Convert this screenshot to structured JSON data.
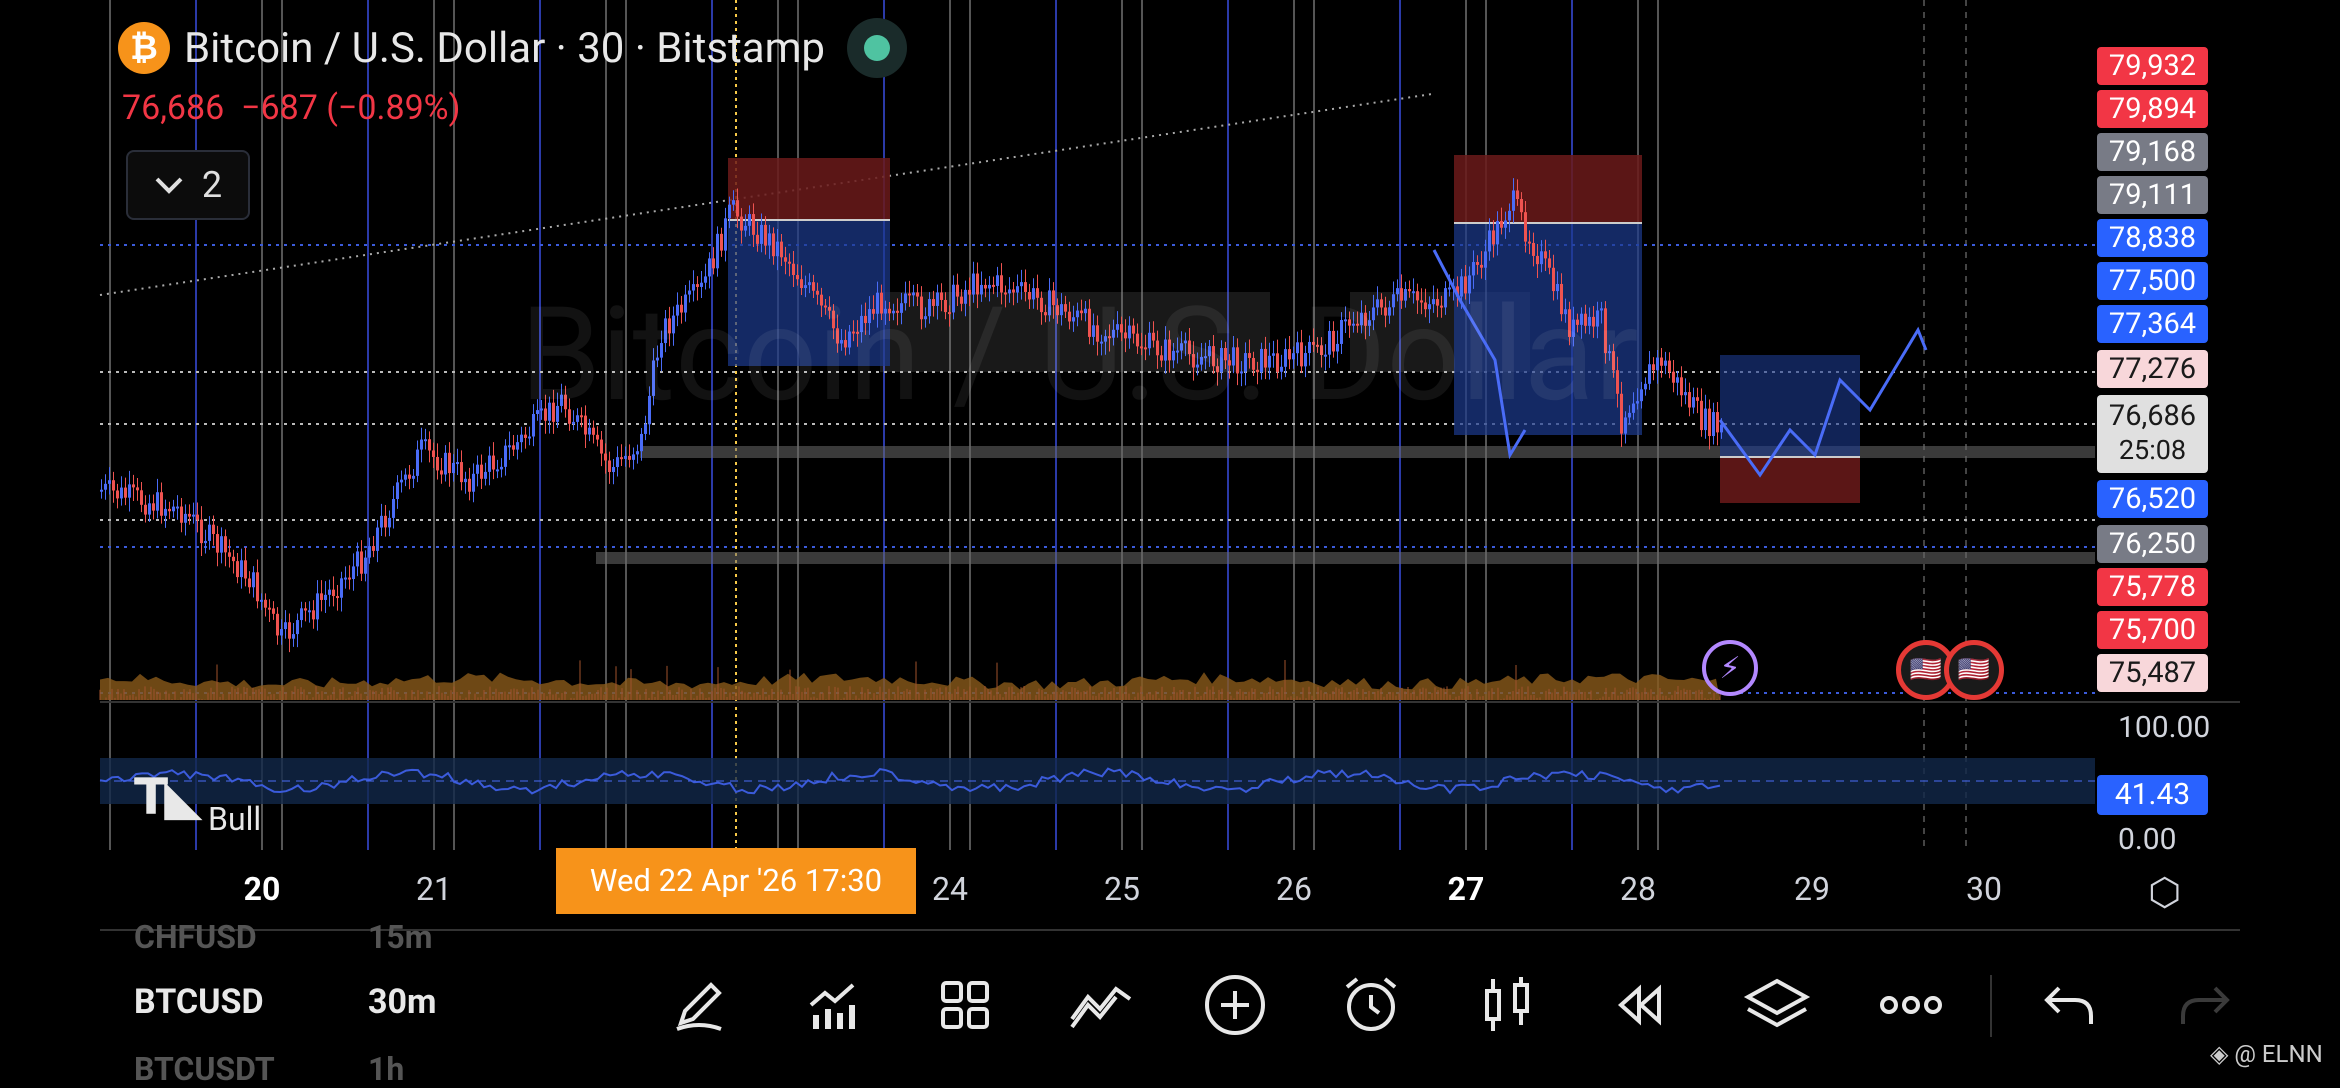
{
  "header": {
    "coin_symbol": "₿",
    "title": "Bitcoin / U.S. Dollar · 30 · Bitstamp",
    "last_price": "76,686",
    "change": "−687 (−0.89%)",
    "indicator_count": "2",
    "watermark": "Bitcoin / U.S. Dollar"
  },
  "price_labels": [
    {
      "text": "79,932",
      "bg": "#f23645",
      "fg": "#ffffff"
    },
    {
      "text": "79,894",
      "bg": "#f23645",
      "fg": "#ffffff"
    },
    {
      "text": "79,168",
      "bg": "#787b86",
      "fg": "#ffffff"
    },
    {
      "text": "79,111",
      "bg": "#787b86",
      "fg": "#ffffff"
    },
    {
      "text": "78,838",
      "bg": "#2962ff",
      "fg": "#ffffff"
    },
    {
      "text": "77,500",
      "bg": "#2962ff",
      "fg": "#ffffff"
    },
    {
      "text": "77,364",
      "bg": "#2962ff",
      "fg": "#ffffff"
    },
    {
      "text": "77,276",
      "bg": "#f8d7da",
      "fg": "#1a1a1a"
    },
    {
      "text": "76,686",
      "bg": "#e0e0e0",
      "fg": "#1a1a1a"
    },
    {
      "text": "76,520",
      "bg": "#2962ff",
      "fg": "#ffffff"
    },
    {
      "text": "76,250",
      "bg": "#787b86",
      "fg": "#ffffff"
    },
    {
      "text": "75,778",
      "bg": "#f23645",
      "fg": "#ffffff"
    },
    {
      "text": "75,700",
      "bg": "#f23645",
      "fg": "#ffffff"
    },
    {
      "text": "75,487",
      "bg": "#f8d7da",
      "fg": "#1a1a1a"
    }
  ],
  "countdown": "25:08",
  "rsi": {
    "top": "100.00",
    "value": "41.43",
    "bottom": "0.00",
    "label": "Bull"
  },
  "x_axis": {
    "ticks": [
      {
        "label": "20",
        "bold": true
      },
      {
        "label": "21",
        "bold": false
      },
      {
        "label": "24",
        "bold": false
      },
      {
        "label": "25",
        "bold": false
      },
      {
        "label": "26",
        "bold": false
      },
      {
        "label": "27",
        "bold": true
      },
      {
        "label": "28",
        "bold": false
      },
      {
        "label": "29",
        "bold": false
      },
      {
        "label": "30",
        "bold": false
      }
    ],
    "crosshair_label": "Wed 22 Apr '26   17:30"
  },
  "watchlist": {
    "ghost_top": {
      "symbol": "CHFUSD",
      "interval": "15m"
    },
    "current": {
      "symbol": "BTCUSD",
      "interval": "30m"
    },
    "ghost_bottom": {
      "symbol": "BTCUSDT",
      "interval": "1h"
    }
  },
  "toolbar_icons": [
    "pen-icon",
    "chart-line-icon",
    "grid-icon",
    "draw-tools-icon",
    "plus-circle-icon",
    "alarm-icon",
    "candles-icon",
    "replay-icon",
    "layers-icon",
    "more-icon",
    "undo-icon",
    "redo-icon"
  ],
  "credit": "◈ @ ELNN",
  "colors": {
    "up": "#4a6cf7",
    "down": "#ef5350",
    "volume": "#8a5a1a",
    "accent": "#f7931a"
  }
}
